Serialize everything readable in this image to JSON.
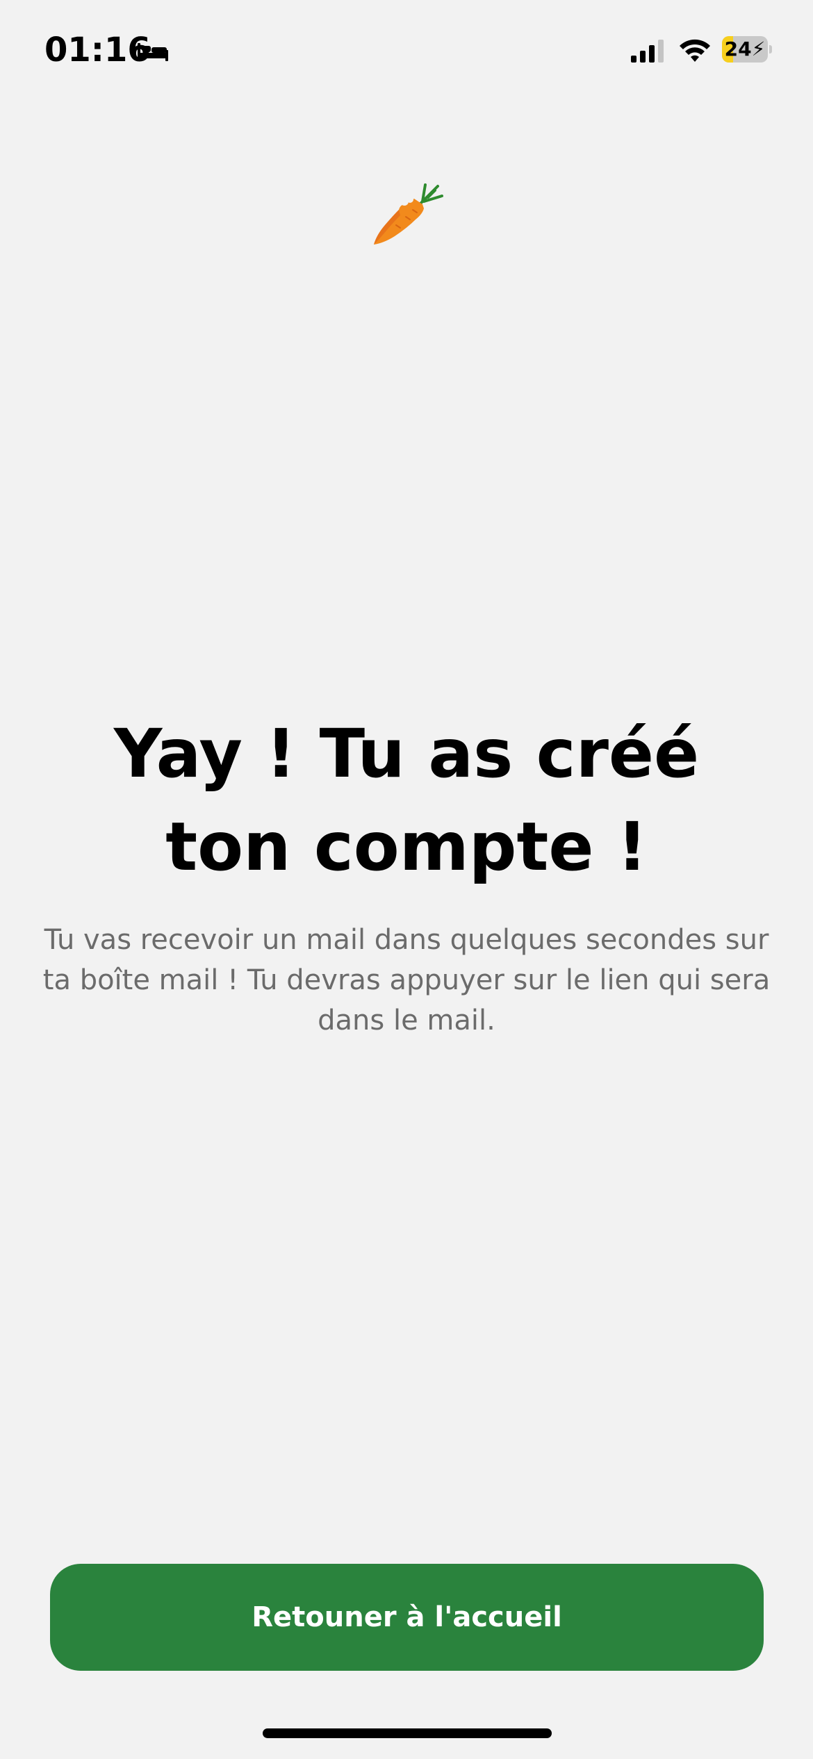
{
  "status_bar": {
    "time": "01:16",
    "sleep_icon": "bed-icon",
    "signal_icon": "cellular-signal-icon",
    "signal_bars_active": 3,
    "wifi_icon": "wifi-icon",
    "battery_level": "24",
    "battery_fill_percent": 24,
    "battery_charging": true,
    "battery_color": "#f7cf1d"
  },
  "hero": {
    "icon": "carrot-icon"
  },
  "main": {
    "title": "Yay ! Tu as créé ton compte !",
    "subtitle": "Tu vas recevoir un mail dans quelques secondes sur ta boîte mail ! Tu devras appuyer sur le lien qui sera dans le mail."
  },
  "actions": {
    "home_button_label": "Retouner à l'accueil",
    "button_color": "#2a833d"
  }
}
